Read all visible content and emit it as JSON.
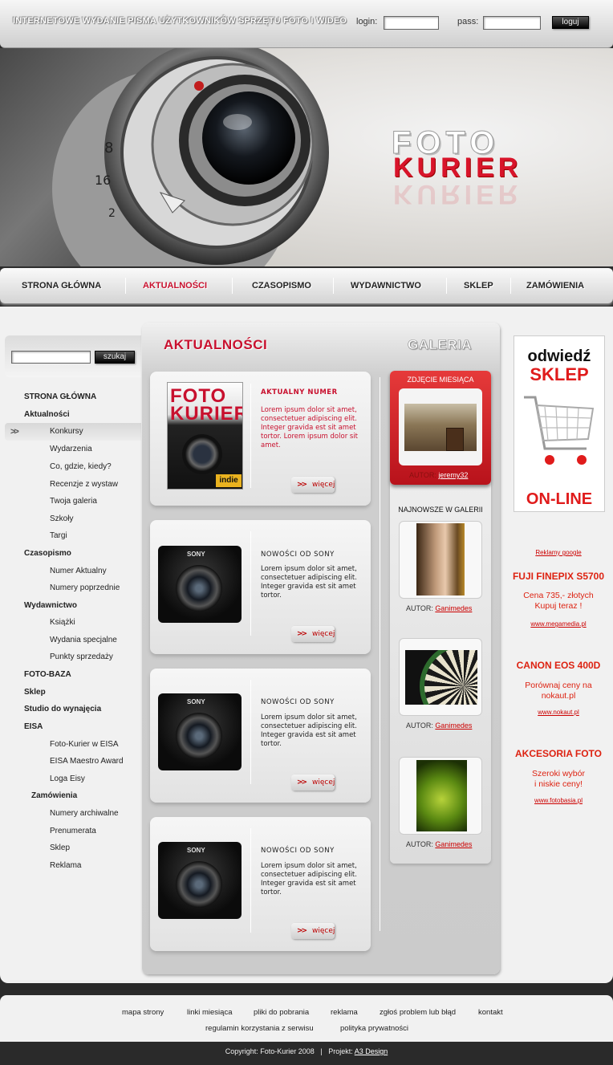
{
  "header": {
    "tagline": "INTERNETOWE WYDANIE PISMA UŻYTKOWNIKÓW SPRZĘTU FOTO I WIDEO",
    "login_label": "login:",
    "pass_label": "pass:",
    "login_button": "loguj"
  },
  "hero": {
    "logo_line1": "FOTO",
    "logo_line2": "KURIER"
  },
  "nav": [
    "STRONA GŁÓWNA",
    "AKTUALNOŚCI",
    "CZASOPISMO",
    "WYDAWNICTWO",
    "SKLEP",
    "ZAMÓWIENIA"
  ],
  "search": {
    "button": "szukaj"
  },
  "sidebar": [
    {
      "label": "STRONA GŁÓWNA"
    },
    {
      "label": "Aktualności"
    },
    {
      "label": "Konkursy"
    },
    {
      "label": "Wydarzenia"
    },
    {
      "label": "Co, gdzie, kiedy?"
    },
    {
      "label": "Recenzje z wystaw"
    },
    {
      "label": "Twoja galeria"
    },
    {
      "label": "Szkoły"
    },
    {
      "label": "Targi"
    },
    {
      "label": "Czasopismo"
    },
    {
      "label": "Numer Aktualny"
    },
    {
      "label": "Numery poprzednie"
    },
    {
      "label": "Wydawnictwo"
    },
    {
      "label": "Książki"
    },
    {
      "label": "Wydania specjalne"
    },
    {
      "label": "Punkty sprzedaży"
    },
    {
      "label": "FOTO-BAZA"
    },
    {
      "label": "Sklep"
    },
    {
      "label": "Studio do wynajęcia"
    },
    {
      "label": "EISA"
    },
    {
      "label": "Foto-Kurier w EISA"
    },
    {
      "label": "EISA Maestro Award"
    },
    {
      "label": "Loga Eisy"
    },
    {
      "label": "Zamówienia"
    },
    {
      "label": "Numery archiwalne"
    },
    {
      "label": "Prenumerata"
    },
    {
      "label": "Sklep"
    },
    {
      "label": "Reklama"
    }
  ],
  "center": {
    "title": "AKTUALNOŚCI",
    "gallery_title": "GALERIA",
    "news": [
      {
        "heading": "AKTUALNY NUMER",
        "text": "Lorem ipsum dolor sit amet, consectetuer adipiscing elit. Integer gravida est sit amet tortor. Lorem ipsum dolor sit amet.",
        "more": "więcej"
      },
      {
        "heading": "NOWOŚCI OD SONY",
        "text": "Lorem ipsum dolor sit amet, consectetuer adipiscing elit. Integer gravida est sit amet tortor.",
        "more": "więcej"
      },
      {
        "heading": "NOWOŚCI OD SONY",
        "text": "Lorem ipsum dolor sit amet, consectetuer adipiscing elit. Integer gravida est sit amet tortor.",
        "more": "więcej"
      },
      {
        "heading": "NOWOŚCI OD SONY",
        "text": "Lorem ipsum dolor sit amet, consectetuer adipiscing elit. Integer gravida est sit amet tortor.",
        "more": "więcej"
      }
    ],
    "magazine": {
      "title": "FOTO KURIER",
      "badge": "indie"
    },
    "camera_brand": "SONY"
  },
  "gallery": {
    "photo_of_month": "ZDJĘCIE MIESIĄCA",
    "potm_author_label": "AUTOR:",
    "potm_author": "jeremy32",
    "newest": "NAJNOWSZE W GALERII",
    "items": [
      {
        "author_label": "AUTOR:",
        "author": "Ganimedes"
      },
      {
        "author_label": "AUTOR:",
        "author": "Ganimedes"
      },
      {
        "author_label": "AUTOR:",
        "author": "Ganimedes"
      }
    ]
  },
  "ads": {
    "shop_line1": "odwiedź",
    "shop_line2": "SKLEP",
    "shop_line3": "ON-LINE",
    "google": "Reklamy google",
    "items": [
      {
        "title": "FUJI FINEPIX S5700",
        "text1": "Cena 735,- złotych",
        "text2": "Kupuj teraz !",
        "link": "www.megamedia.pl"
      },
      {
        "title": "CANON EOS 400D",
        "text1": "Porównaj ceny na",
        "text2": "nokaut.pl",
        "link": "www.nokaut.pl"
      },
      {
        "title": "AKCESORIA FOTO",
        "text1": "Szeroki wybór",
        "text2": "i niskie ceny!",
        "link": "www.fotobasia.pl"
      }
    ]
  },
  "footer": {
    "links_row1": [
      "mapa strony",
      "linki miesiąca",
      "pliki do pobrania",
      "reklama",
      "zgłoś problem lub błąd",
      "kontakt"
    ],
    "links_row2": [
      "regulamin korzystania z serwisu",
      "polityka prywatności"
    ],
    "copyright": "Copyright: Foto-Kurier 2008",
    "sep": "|",
    "project_label": "Projekt:",
    "project_link": "A3 Design"
  },
  "colors": {
    "accent": "#c8102e",
    "dark": "#2a2a2a"
  }
}
